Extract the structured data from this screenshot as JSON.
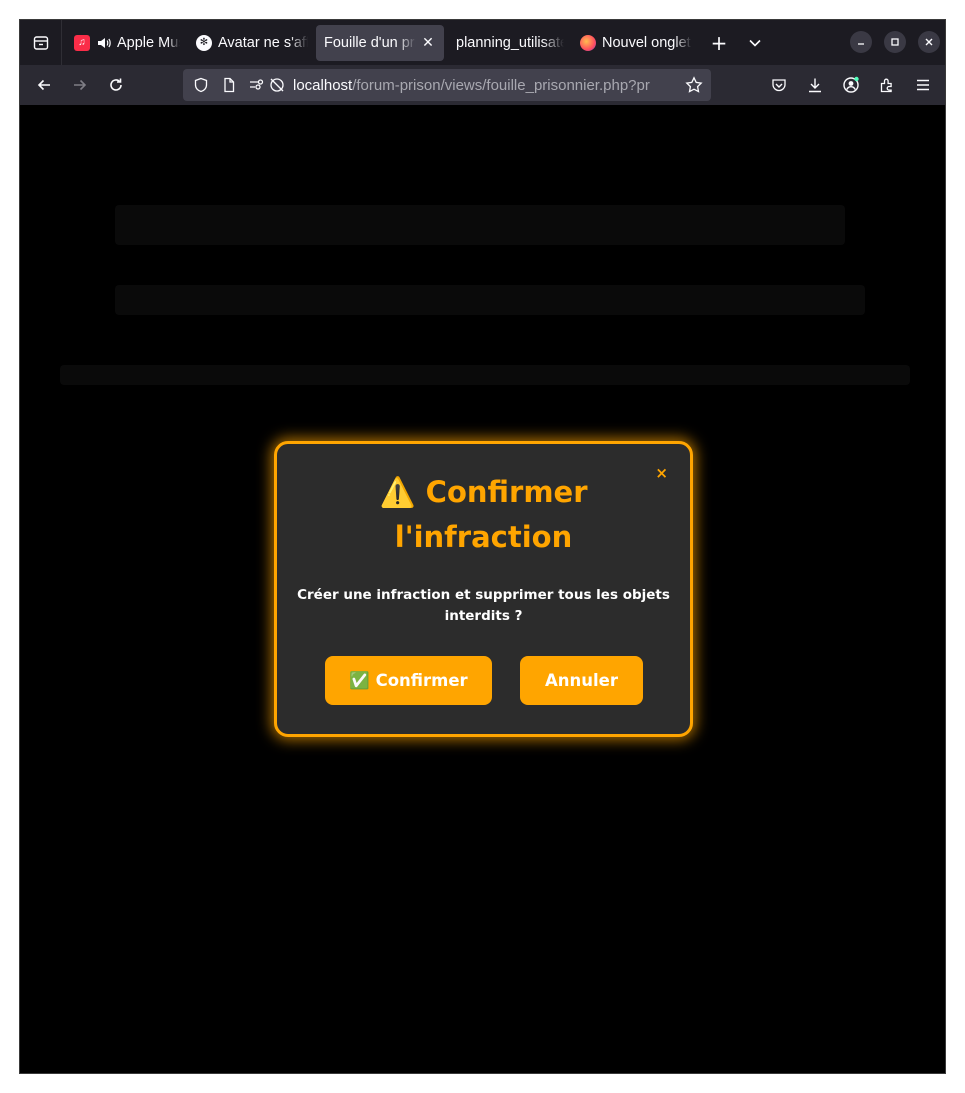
{
  "tabs": [
    {
      "label": "Apple Music",
      "favicon": "apple-music-icon",
      "audio": true
    },
    {
      "label": "Avatar ne s'affiche pas",
      "favicon": "openai-icon"
    },
    {
      "label": "Fouille d'un prisonnier",
      "active": true,
      "close_glyph": "✕"
    },
    {
      "label": "planning_utilisateur"
    },
    {
      "label": "Nouvel onglet",
      "favicon": "firefox-icon"
    }
  ],
  "tabbar": {
    "new_tab": "+",
    "list_tabs": "⌄"
  },
  "url": {
    "host": "localhost",
    "path": "/forum-prison/views/fouille_prisonnier.php?pr"
  },
  "modal": {
    "title": "⚠️ Confirmer l'infraction",
    "close": "×",
    "message": "Créer une infraction et supprimer tous les objets interdits ?",
    "confirm_label": "✅ Confirmer",
    "cancel_label": "Annuler"
  },
  "colors": {
    "accent": "#ffa500",
    "modal_bg": "#2c2c2c",
    "tabbar_bg": "#1c1b22",
    "navbar_bg": "#2b2a33"
  }
}
